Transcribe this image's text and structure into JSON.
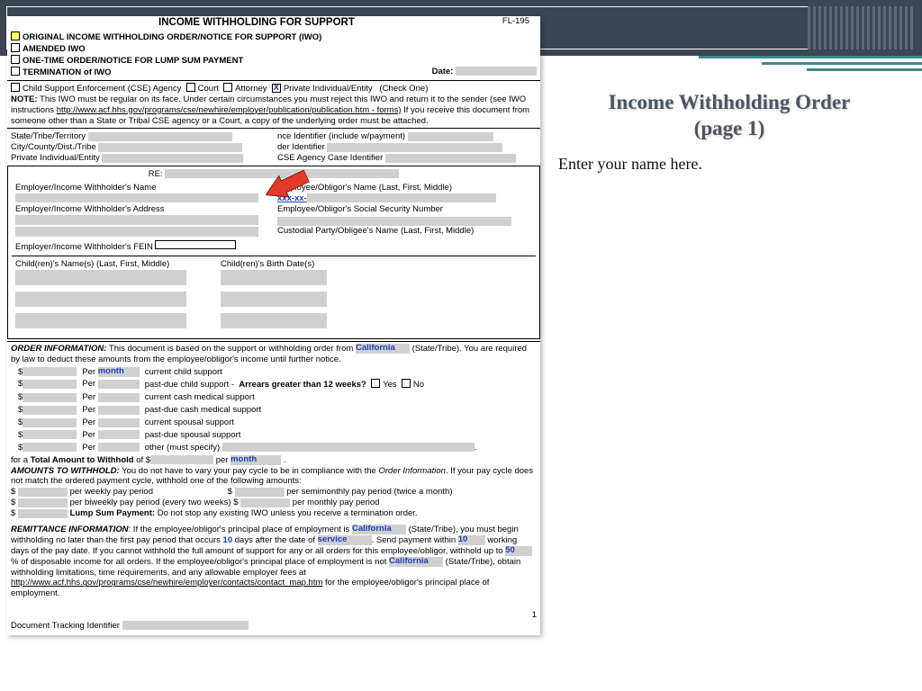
{
  "slide": {
    "title_line1": "Income Withholding Order",
    "title_line2": "(page 1)",
    "prompt": "Enter your name here."
  },
  "form": {
    "form_number": "FL-195",
    "main_title": "INCOME WITHHOLDING FOR SUPPORT",
    "options": {
      "original": "ORIGINAL INCOME WITHHOLDING ORDER/NOTICE FOR SUPPORT (IWO)",
      "amended": "AMENDED IWO",
      "onetime": "ONE-TIME ORDER/NOTICE FOR LUMP SUM PAYMENT",
      "termination": "TERMINATION of IWO",
      "date_label": "Date:"
    },
    "checkone": {
      "cse": "Child Support Enforcement (CSE) Agency",
      "court": "Court",
      "attorney": "Attorney",
      "private": "Private Individual/Entity",
      "note": "(Check One)"
    },
    "note_label": "NOTE:",
    "note_text": "This IWO must be regular on its face. Under certain circumstances you must reject this IWO and return it to the sender (see IWO instructions ",
    "note_link": "http://www.acf.hhs.gov/programs/cse/newhire/employer/publication/publication.htm - forms)",
    "note_tail": " If you receive this document from someone other than a State or Tribal CSE agency or a Court, a copy of the underlying order must be attached.",
    "idrows": {
      "state_lbl": "State/Tribe/Territory",
      "city_lbl": "City/County/Dist./Tribe",
      "priv_lbl": "Private Individual/Entity",
      "remit_lbl": "nce Identifier (include w/payment)",
      "order_lbl": "der Identifier",
      "case_lbl": "CSE Agency Case Identifier"
    },
    "parties": {
      "re": "RE:",
      "emp_name": "Employer/Income Withholder's Name",
      "emp_addr": "Employer/Income Withholder's Address",
      "emp_fein": "Employer/Income Withholder's FEIN",
      "ee_name": "Employee/Obligor's Name (Last, First, Middle)",
      "ssn_mask": "xxx-xx-",
      "ssn_lbl": "Employee/Obligor's Social Security Number",
      "cust_lbl": "Custodial Party/Obligee's Name (Last, First, Middle)",
      "child_names": "Child(ren)'s Name(s) (Last, First, Middle)",
      "child_dob": "Child(ren)'s Birth Date(s)"
    },
    "order_info": {
      "head": "ORDER INFORMATION:",
      "lead": " This document is based on the support or withholding order from ",
      "state_val": "California",
      "state_tail": "(State/Tribe). You are required by law to deduct these amounts from the employee/obligor's income until further notice.",
      "per": "Per",
      "month": "month",
      "lines": [
        "current child support",
        "past-due child support -",
        "current cash medical support",
        "past-due cash medical support",
        "current spousal support",
        "past-due spousal support",
        "other (must specify)"
      ],
      "arrears_q": "Arrears greater than 12 weeks?",
      "yes": "Yes",
      "no": "No",
      "total_lead": "for a ",
      "total_b": "Total Amount to Withhold",
      "total_mid": " of $",
      "total_per": " per "
    },
    "amounts": {
      "head": "AMOUNTS TO WITHHOLD:",
      "lead": " You do not have to vary your pay cycle to be in compliance with the ",
      "oi_i": "Order Information",
      "tail": ". If your pay cycle does not match the ordered payment cycle, withhold one of the following amounts:",
      "wk": "per weekly pay period",
      "semi": "per semimonthly pay period (twice a month)",
      "biwk": "per biweekly pay period (every two weeks) $",
      "mo": "per monthly pay period",
      "lump_b": "Lump Sum Payment:",
      "lump_t": " Do not stop any existing IWO unless you receive a termination order."
    },
    "remit": {
      "head": "REMITTANCE INFORMATION",
      "lead": ": If the employee/obligor's principal place of employment is ",
      "state1": "California",
      "t1": " (State/Tribe), you must begin withholding no later than the first pay period that occurs",
      "v10a": "10",
      "t2": " days after the date of ",
      "service": "service",
      "t3": ". Send payment within ",
      "v10b": "10",
      "t4": " working days of the pay date. If you cannot withhold the full amount of support for any or all orders for this employee/obligor, withhold up to ",
      "v50": "50",
      "t5": " % of disposable income for all orders. If the employee/obligor's principal place of employment is not ",
      "state2": "California",
      "t6": " (State/Tribe), obtain withholding limitations, time requirements, and any allowable employer fees at ",
      "link": "http://www.acf.hhs.gov/programs/cse/newhire/employer/contacts/contact_map.htm",
      "t7": " for the employee/obligor's principal place of employment."
    },
    "footer": {
      "page": "1",
      "track": "Document Tracking Identifier"
    }
  }
}
